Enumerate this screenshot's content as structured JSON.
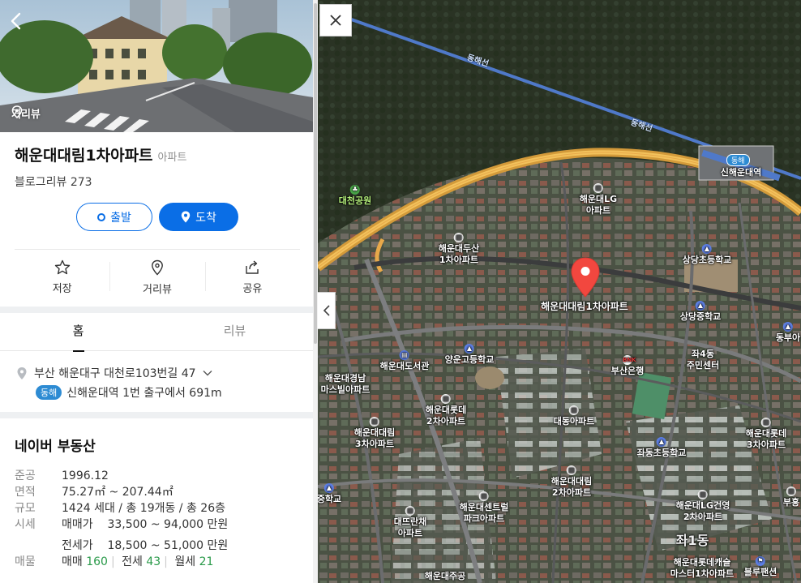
{
  "panel": {
    "back_icon": "chevron-left-icon",
    "streetview_label": "거리뷰",
    "place": {
      "name": "해운대대림1차아파트",
      "category": "아파트",
      "blog_review_label": "블로그리뷰",
      "blog_review_count": "273"
    },
    "route_buttons": {
      "depart": "출발",
      "arrive": "도착"
    },
    "actions": [
      {
        "label": "저장",
        "icon": "star-icon"
      },
      {
        "label": "거리뷰",
        "icon": "location-pin-icon"
      },
      {
        "label": "공유",
        "icon": "share-icon"
      }
    ],
    "tabs": [
      {
        "label": "홈",
        "active": true
      },
      {
        "label": "리뷰",
        "active": false
      }
    ],
    "address": "부산 해운대구 대천로103번길 47",
    "subway": {
      "line_badge": "동해",
      "text": "신해운대역 1번 출구에서 691m",
      "line_color": "#2d8bd3"
    },
    "real_estate": {
      "title": "네이버 부동산",
      "rows": [
        {
          "key": "준공",
          "value": "1996.12"
        },
        {
          "key": "면적",
          "value": "75.27㎡ ~ 207.44㎡"
        },
        {
          "key": "규모",
          "value": "1424 세대 / 총 19개동 / 총 26층"
        },
        {
          "key": "시세",
          "value": "매매가    33,500 ~ 94,000 만원"
        },
        {
          "key": "",
          "value": "전세가    18,500 ~ 51,000 만원"
        }
      ],
      "listing": {
        "key": "매물",
        "sale_label": "매매",
        "sale_count": "160",
        "jeonse_label": "전세",
        "jeonse_count": "43",
        "monthly_label": "월세",
        "monthly_count": "21"
      }
    },
    "accent_color": "#0a6ee6"
  },
  "map": {
    "close_icon": "close-icon",
    "collapse_icon": "chevron-left-icon",
    "rail_labels": [
      "동해선",
      "동해선"
    ],
    "station_badge": "동해",
    "labels": [
      {
        "text": "신해운대역",
        "kind": "station"
      },
      {
        "text": "대천공원",
        "kind": "park"
      },
      {
        "text": "해운대LG\n아파트",
        "kind": "apt"
      },
      {
        "text": "해운대두산\n1차아파트",
        "kind": "apt"
      },
      {
        "text": "상당초등학교",
        "kind": "school"
      },
      {
        "text": "해운대대림1차아파트",
        "kind": "selected"
      },
      {
        "text": "상당중학교",
        "kind": "school"
      },
      {
        "text": "양운고등학교",
        "kind": "school"
      },
      {
        "text": "해운대도서관",
        "kind": "library"
      },
      {
        "text": "부산은행",
        "kind": "bank"
      },
      {
        "text": "좌4동\n주민센터",
        "kind": "office"
      },
      {
        "text": "동부아",
        "kind": "apt"
      },
      {
        "text": "해운대경남\n마스빌아파트",
        "kind": "apt"
      },
      {
        "text": "해운대롯데\n2차아파트",
        "kind": "apt"
      },
      {
        "text": "대동아파트",
        "kind": "apt"
      },
      {
        "text": "해운대대림\n3차아파트",
        "kind": "apt"
      },
      {
        "text": "좌동초등학교",
        "kind": "school"
      },
      {
        "text": "해운대롯데\n3차아파트",
        "kind": "apt"
      },
      {
        "text": "해운대대림\n2차아파트",
        "kind": "apt"
      },
      {
        "text": "중학교",
        "kind": "school"
      },
      {
        "text": "해운대센트럴\n파크아파트",
        "kind": "apt"
      },
      {
        "text": "해운대LG건영\n2차아파트",
        "kind": "apt"
      },
      {
        "text": "부흥",
        "kind": "apt"
      },
      {
        "text": "대뜨란채\n아파트",
        "kind": "apt"
      },
      {
        "text": "좌1동",
        "kind": "district"
      },
      {
        "text": "해운대롯데캐슬\n마스터1차아파트",
        "kind": "apt"
      },
      {
        "text": "블루팬션",
        "kind": "other"
      },
      {
        "text": "해운대주공",
        "kind": "apt"
      }
    ],
    "pin_color": "#f2473f"
  }
}
